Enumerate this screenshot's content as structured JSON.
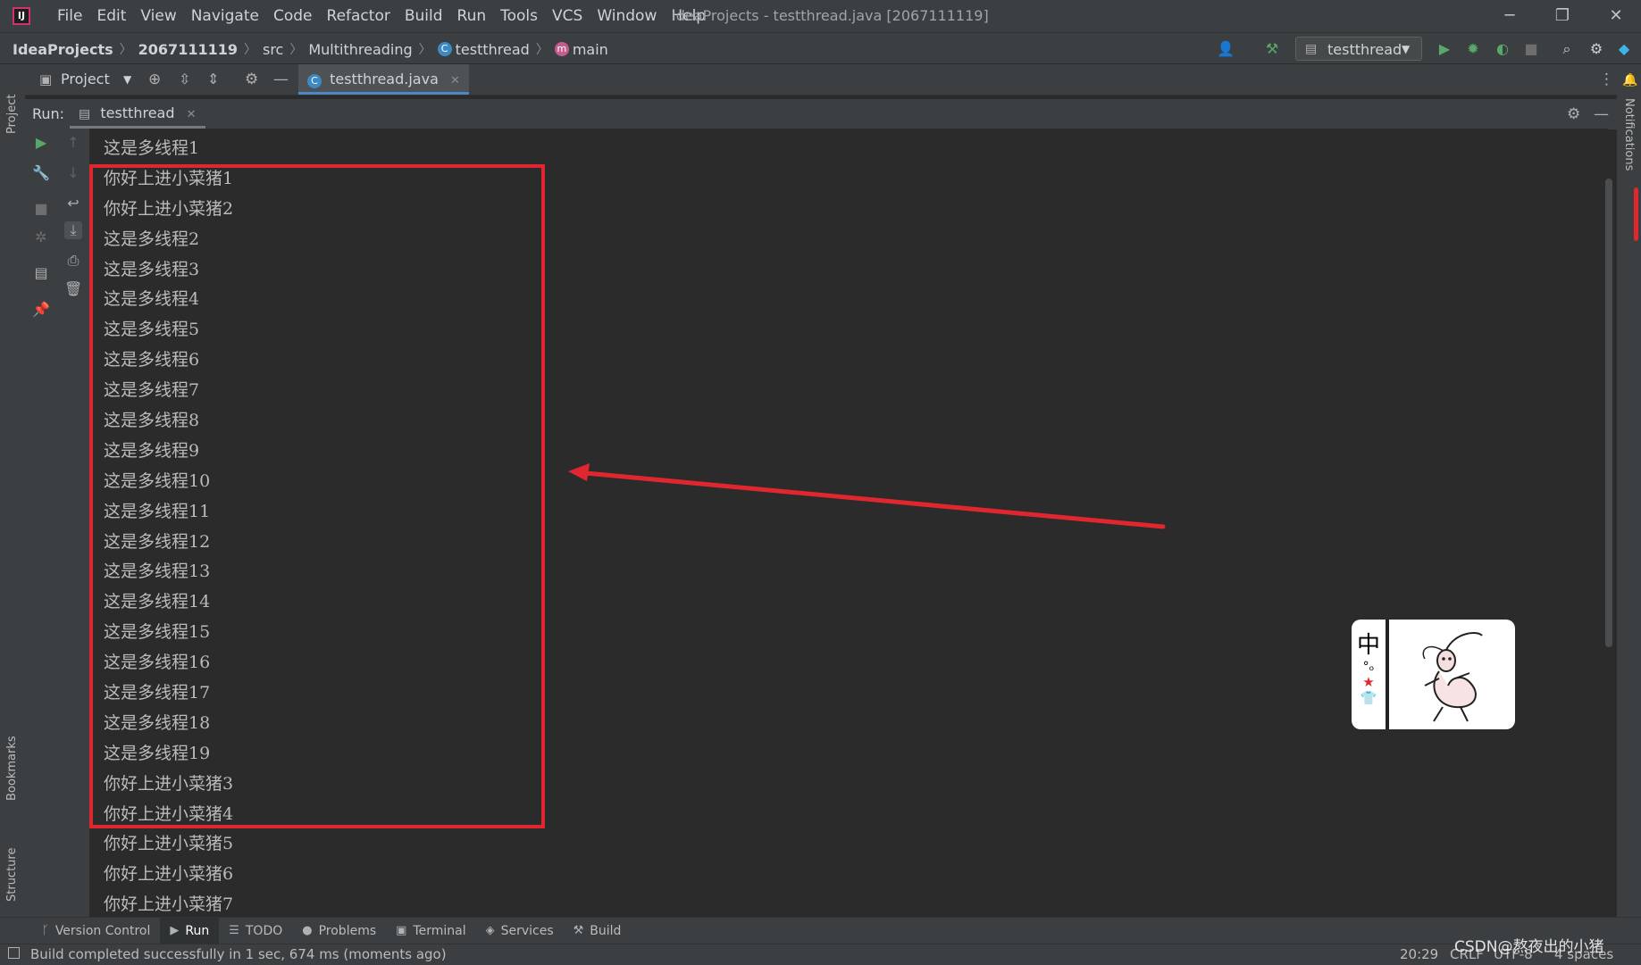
{
  "titlebar": {
    "logo_text": "IJ",
    "menu": [
      "File",
      "Edit",
      "View",
      "Navigate",
      "Code",
      "Refactor",
      "Build",
      "Run",
      "Tools",
      "VCS",
      "Window",
      "Help"
    ],
    "window_title": "IdeaProjects - testthread.java [2067111119]",
    "controls": {
      "minimize": "─",
      "restore": "❐",
      "close": "✕"
    }
  },
  "navbar": {
    "breadcrumb": [
      "IdeaProjects",
      "2067111119",
      "src",
      "Multithreading",
      "testthread",
      "main"
    ],
    "run_config": "testthread",
    "icons": [
      "user-icon",
      "hammer-icon",
      "run-icon",
      "debug-icon",
      "coverage-icon",
      "stop-icon",
      "search-icon",
      "settings-icon",
      "toolbox-icon"
    ]
  },
  "tool_window": {
    "project_label": "Project",
    "editor_tab": "testthread.java"
  },
  "run_panel": {
    "run_label": "Run:",
    "tab": "testthread"
  },
  "left_stripe": {
    "top": "Project",
    "bookmarks": "Bookmarks",
    "structure": "Structure"
  },
  "right_stripe": {
    "notifications": "Notifications"
  },
  "console": {
    "lines": [
      "这是多线程1",
      "你好上进小菜猪1",
      "你好上进小菜猪2",
      "这是多线程2",
      "这是多线程3",
      "这是多线程4",
      "这是多线程5",
      "这是多线程6",
      "这是多线程7",
      "这是多线程8",
      "这是多线程9",
      "这是多线程10",
      "这是多线程11",
      "这是多线程12",
      "这是多线程13",
      "这是多线程14",
      "这是多线程15",
      "这是多线程16",
      "这是多线程17",
      "这是多线程18",
      "这是多线程19",
      "你好上进小菜猪3",
      "你好上进小菜猪4",
      "你好上进小菜猪5",
      "你好上进小菜猪6",
      "你好上进小菜猪7"
    ]
  },
  "sticker": {
    "side_char": "中",
    "side_glyphs": [
      "°ₒ",
      "★",
      "👕"
    ]
  },
  "bottom_toolbar": {
    "items": [
      {
        "label": "Version Control",
        "icon": "branch-icon",
        "glyph": "ᚴ"
      },
      {
        "label": "Run",
        "icon": "run-icon",
        "glyph": "▶",
        "active": true
      },
      {
        "label": "TODO",
        "icon": "list-icon",
        "glyph": "☰"
      },
      {
        "label": "Problems",
        "icon": "problems-icon",
        "glyph": "●"
      },
      {
        "label": "Terminal",
        "icon": "terminal-icon",
        "glyph": "▣"
      },
      {
        "label": "Services",
        "icon": "services-icon",
        "glyph": "◈"
      },
      {
        "label": "Build",
        "icon": "hammer-icon",
        "glyph": "⚒"
      }
    ]
  },
  "statusbar": {
    "message": "Build completed successfully in 1 sec, 674 ms (moments ago)",
    "position": "20:29",
    "line_sep": "CRLF",
    "encoding": "UTF-8",
    "indent": "4 spaces"
  },
  "watermark": "CSDN@熬夜出的小猪",
  "colors": {
    "highlight": "#e0262f",
    "accent": "#4a88c7",
    "run_green": "#59a869"
  }
}
